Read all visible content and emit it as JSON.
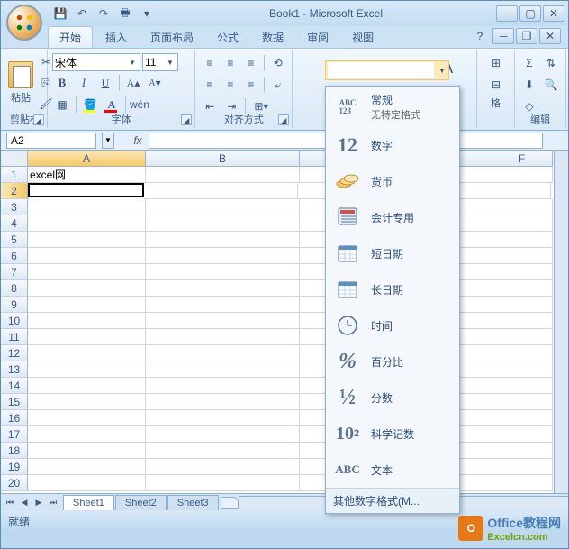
{
  "title": "Book1 - Microsoft Excel",
  "tabs": {
    "home": "开始",
    "insert": "插入",
    "layout": "页面布局",
    "formulas": "公式",
    "data": "数据",
    "review": "审阅",
    "view": "视图"
  },
  "ribbon": {
    "clipboard": {
      "label": "剪贴板",
      "paste": "粘贴"
    },
    "font": {
      "label": "字体",
      "name": "宋体",
      "size": "11",
      "bold": "B",
      "italic": "I",
      "underline": "U",
      "aplus": "A",
      "aminus": "A"
    },
    "alignment": {
      "label": "对齐方式"
    },
    "number": {
      "label": "格"
    },
    "editing": {
      "label": "编辑"
    }
  },
  "formatDropdown": {
    "general": {
      "label": "常规",
      "sub": "无特定格式",
      "icon": "ABC\n123"
    },
    "number": {
      "label": "数字",
      "icon": "12"
    },
    "currency": {
      "label": "货币"
    },
    "accounting": {
      "label": "会计专用"
    },
    "shortdate": {
      "label": "短日期"
    },
    "longdate": {
      "label": "长日期"
    },
    "time": {
      "label": "时间"
    },
    "percentage": {
      "label": "百分比",
      "icon": "%"
    },
    "fraction": {
      "label": "分数",
      "icon": "½"
    },
    "scientific": {
      "label": "科学记数",
      "icon": "10²"
    },
    "text": {
      "label": "文本",
      "icon": "ABC"
    },
    "more": "其他数字格式(M..."
  },
  "namebox": "A2",
  "fx": "fx",
  "columns": [
    "A",
    "B",
    "F"
  ],
  "rows": [
    "1",
    "2",
    "3",
    "4",
    "5",
    "6",
    "7",
    "8",
    "9",
    "10",
    "11",
    "12",
    "13",
    "14",
    "15",
    "16",
    "17",
    "18",
    "19",
    "20"
  ],
  "cellA1": "excel网",
  "sheets": {
    "s1": "Sheet1",
    "s2": "Sheet2",
    "s3": "Sheet3"
  },
  "status": "就绪",
  "watermark": {
    "t1": "Office教程网",
    "t2": "Excelcn.com"
  }
}
